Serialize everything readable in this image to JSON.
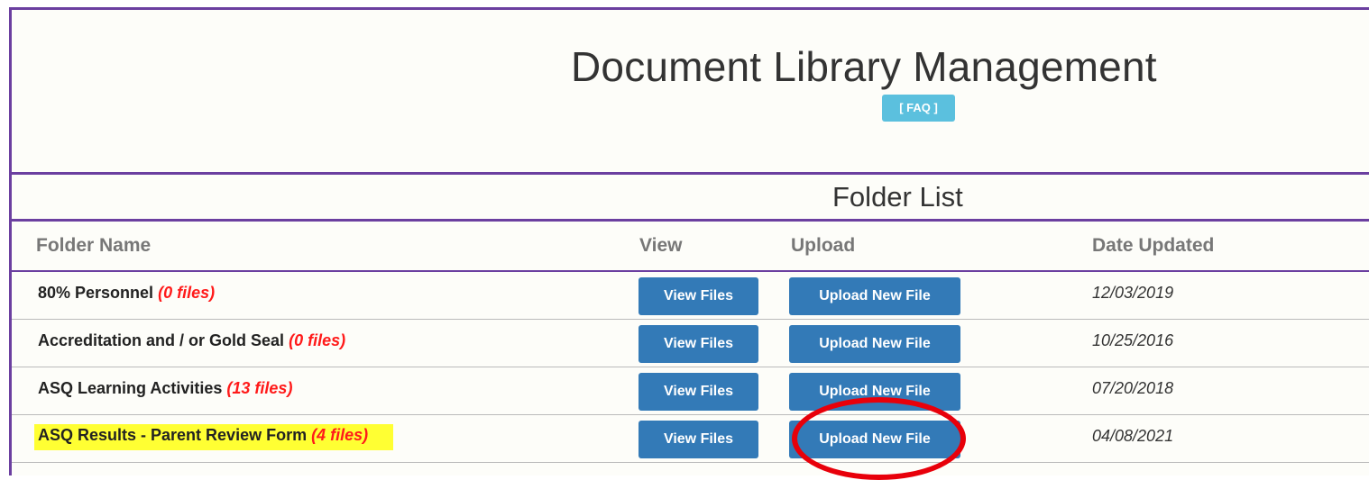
{
  "header": {
    "title": "Document Library Management",
    "faq_label": "[ FAQ ]"
  },
  "folder_list": {
    "title": "Folder List",
    "columns": {
      "folder_name": "Folder Name",
      "view": "View",
      "upload": "Upload",
      "date_updated": "Date Updated"
    },
    "rows": [
      {
        "name": "80% Personnel",
        "file_count": "(0 files)",
        "view_label": "View Files",
        "upload_label": "Upload New File",
        "date": "12/03/2019"
      },
      {
        "name": "Accreditation and / or Gold Seal",
        "file_count": "(0 files)",
        "view_label": "View Files",
        "upload_label": "Upload New File",
        "date": "10/25/2016"
      },
      {
        "name": "ASQ Learning Activities",
        "file_count": "(13 files)",
        "view_label": "View Files",
        "upload_label": "Upload New File",
        "date": "07/20/2018"
      },
      {
        "name": "ASQ Results - Parent Review Form",
        "file_count": "(4 files)",
        "view_label": "View Files",
        "upload_label": "Upload New File",
        "date": "04/08/2021"
      }
    ]
  },
  "colors": {
    "frame_border": "#6b3fa0",
    "primary_button": "#337ab7",
    "faq_button": "#5bc0de",
    "file_count": "#ff1a1a",
    "highlight": "#ffff33",
    "annotation_circle": "#e8000a"
  }
}
